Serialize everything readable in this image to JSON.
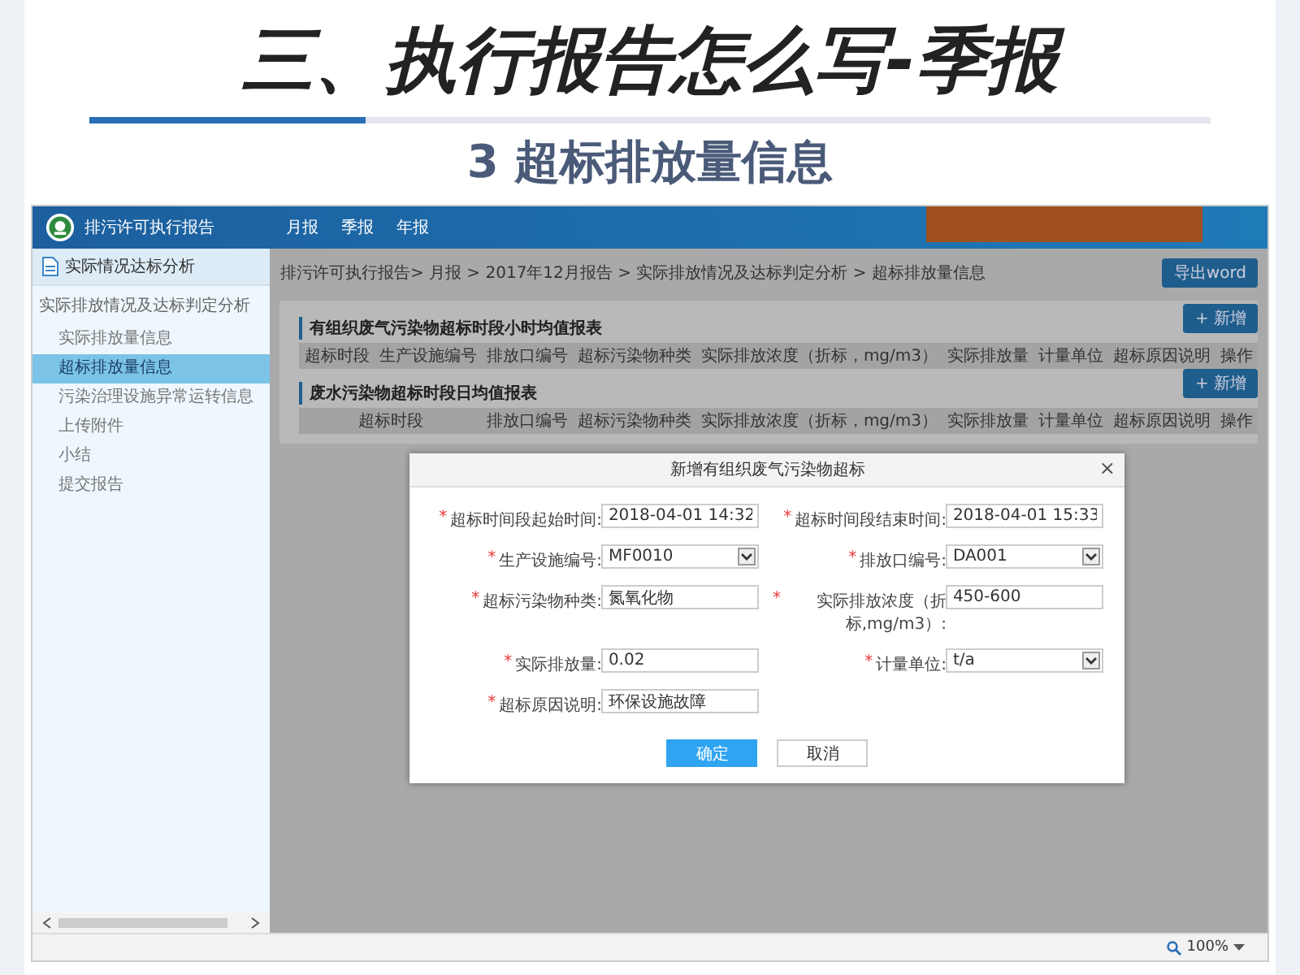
{
  "slide": {
    "title": "三、执行报告怎么写-季报",
    "subtitle": "3 超标排放量信息"
  },
  "app": {
    "name": "排污许可执行报告",
    "nav": [
      "月报",
      "季报",
      "年报"
    ]
  },
  "sidebar": {
    "header": "实际情况达标分析",
    "section": "实际排放情况及达标判定分析",
    "items": [
      {
        "label": "实际排放量信息",
        "selected": false
      },
      {
        "label": "超标排放量信息",
        "selected": true
      },
      {
        "label": "污染治理设施异常运转信息",
        "selected": false
      },
      {
        "label": "上传附件",
        "selected": false
      },
      {
        "label": "小结",
        "selected": false
      },
      {
        "label": "提交报告",
        "selected": false
      }
    ]
  },
  "breadcrumb": "排污许可执行报告> 月报 > 2017年12月报告 > 实际排放情况及达标判定分析 > 超标排放量信息",
  "export_button": "导出word",
  "tables": [
    {
      "title": "有组织废气污染物超标时段小时均值报表",
      "add_button": "+ 新增",
      "columns": [
        "超标时段",
        "生产设施编号",
        "排放口编号",
        "超标污染物种类",
        "实际排放浓度（折标，mg/m3）",
        "实际排放量",
        "计量单位",
        "超标原因说明",
        "操作"
      ]
    },
    {
      "title": "废水污染物超标时段日均值报表",
      "add_button": "+ 新增",
      "columns": [
        "超标时段",
        "排放口编号",
        "超标污染物种类",
        "实际排放浓度（折标，mg/m3）",
        "实际排放量",
        "计量单位",
        "超标原因说明",
        "操作"
      ]
    }
  ],
  "dialog": {
    "title": "新增有组织废气污染物超标",
    "close": "×",
    "fields": [
      {
        "kind": "text",
        "required_mark": "*",
        "label": "超标时间段起始时间:",
        "value": "2018-04-01 14:32"
      },
      {
        "kind": "text",
        "required_mark": "*",
        "label": "超标时间段结束时间:",
        "value": "2018-04-01 15:33"
      },
      {
        "kind": "select",
        "required_mark": "*",
        "label": "生产设施编号:",
        "value": "MF0010"
      },
      {
        "kind": "select",
        "required_mark": "*",
        "label": "排放口编号:",
        "value": "DA001"
      },
      {
        "kind": "text",
        "required_mark": "*",
        "label": "超标污染物种类:",
        "value": "氮氧化物"
      },
      {
        "kind": "text",
        "required_mark": "*",
        "label": "实际排放浓度（折标,mg/m3）:",
        "value": "450-600"
      },
      {
        "kind": "text",
        "required_mark": "*",
        "label": "实际排放量:",
        "value": "0.02"
      },
      {
        "kind": "select",
        "required_mark": "*",
        "label": "计量单位:",
        "value": "t/a"
      },
      {
        "kind": "text",
        "required_mark": "*",
        "label": "超标原因说明:",
        "value": "环保设施故障"
      }
    ],
    "buttons": [
      {
        "label": "确定",
        "kind": "primary"
      },
      {
        "label": "取消",
        "kind": "default"
      }
    ]
  },
  "status_bar": {
    "zoom": "100%"
  }
}
